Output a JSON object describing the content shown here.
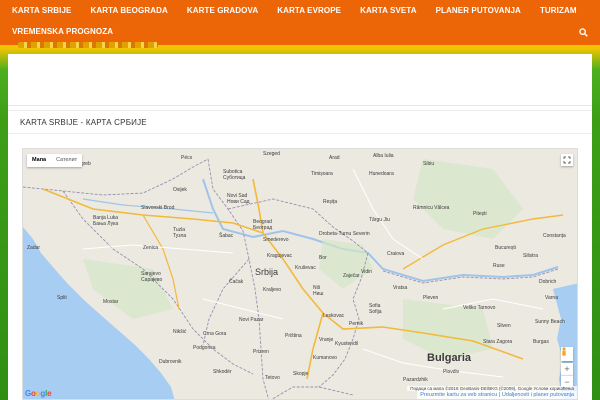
{
  "nav": {
    "row1": [
      "KARTA SRBIJE",
      "KARTA BEOGRADA",
      "KARTE GRADOVA",
      "KARTA EVROPE",
      "KARTA SVETA",
      "PLANER PUTOVANJA",
      "TURIZAM"
    ],
    "row2": [
      "VREMENSKA PROGNOZA"
    ]
  },
  "colors": {
    "nav_bg": "#ec6608",
    "banner_yellow": "#f2c500",
    "grass_green": "#3d9e16",
    "link_blue": "#3a7bd5"
  },
  "page": {
    "title": "KARTA SRBIJE - КАРТА СРБИЈЕ"
  },
  "map": {
    "toggle": {
      "map": "Мапа",
      "satellite": "Сателит"
    },
    "google": [
      "G",
      "o",
      "o",
      "g",
      "l",
      "e"
    ],
    "attribution": "Подаци са мапа ©2018 GeoBasis-DE/BKG (©2009), Google   Услови коришћења",
    "links": {
      "website": "Preuzmite kartu za veb stranicu",
      "separator": " | ",
      "planner": "Udaljenosti i planer putovanja"
    },
    "countries": [
      "Srbija",
      "Bulgaria"
    ],
    "cities": [
      {
        "name": "Zagreb"
      },
      {
        "name": "Pécs"
      },
      {
        "name": "Szeged"
      },
      {
        "name": "Arad"
      },
      {
        "name": "Alba Iulia"
      },
      {
        "name": "Sibiu"
      },
      {
        "name": "Subotica"
      },
      {
        "name": "Суботица"
      },
      {
        "name": "Timișoara"
      },
      {
        "name": "Hunedoara"
      },
      {
        "name": "Osijek"
      },
      {
        "name": "Novi Sad"
      },
      {
        "name": "Нови Сад"
      },
      {
        "name": "Reșița"
      },
      {
        "name": "Râmnicu Vâlcea"
      },
      {
        "name": "Slavonski Brod"
      },
      {
        "name": "Banja Luka"
      },
      {
        "name": "Бања Лука"
      },
      {
        "name": "Beograd"
      },
      {
        "name": "Београд"
      },
      {
        "name": "Târgu Jiu"
      },
      {
        "name": "Pitești"
      },
      {
        "name": "Tuzla"
      },
      {
        "name": "Тузла"
      },
      {
        "name": "Šabac"
      },
      {
        "name": "Zenica"
      },
      {
        "name": "Smederevo"
      },
      {
        "name": "Drobeta-Turnu Severin"
      },
      {
        "name": "Craiova"
      },
      {
        "name": "București"
      },
      {
        "name": "Sarajevo"
      },
      {
        "name": "Сарајево"
      },
      {
        "name": "Kragujevac"
      },
      {
        "name": "Bor"
      },
      {
        "name": "Mostar"
      },
      {
        "name": "Čačak"
      },
      {
        "name": "Kraljevo"
      },
      {
        "name": "Niš"
      },
      {
        "name": "Ниш"
      },
      {
        "name": "Vidin"
      },
      {
        "name": "Ruse"
      },
      {
        "name": "Pleven"
      },
      {
        "name": "Veliko Tarnovo"
      },
      {
        "name": "Podgorica"
      },
      {
        "name": "Nikšić"
      },
      {
        "name": "Crna Gora"
      },
      {
        "name": "Novi Pazar"
      },
      {
        "name": "Priština"
      },
      {
        "name": "Leskovac"
      },
      {
        "name": "Sofia"
      },
      {
        "name": "Sofija"
      },
      {
        "name": "Plovdiv"
      },
      {
        "name": "Burgas"
      },
      {
        "name": "Skopje"
      },
      {
        "name": "Dubrovnik"
      },
      {
        "name": "Split"
      },
      {
        "name": "Kruševac"
      },
      {
        "name": "Zadar"
      },
      {
        "name": "Zaječar"
      },
      {
        "name": "Vratsa"
      },
      {
        "name": "Pernik"
      },
      {
        "name": "Silistra"
      },
      {
        "name": "Dobrich"
      },
      {
        "name": "Varna"
      },
      {
        "name": "Constanța"
      },
      {
        "name": "Stara Zagora"
      },
      {
        "name": "Sliven"
      },
      {
        "name": "Kyustendil"
      },
      {
        "name": "Prizren"
      },
      {
        "name": "Shkodër"
      },
      {
        "name": "Tetovo"
      },
      {
        "name": "Kumanovo"
      },
      {
        "name": "Vranje"
      },
      {
        "name": "Pazardzhik"
      },
      {
        "name": "Sunny Beach"
      }
    ]
  }
}
